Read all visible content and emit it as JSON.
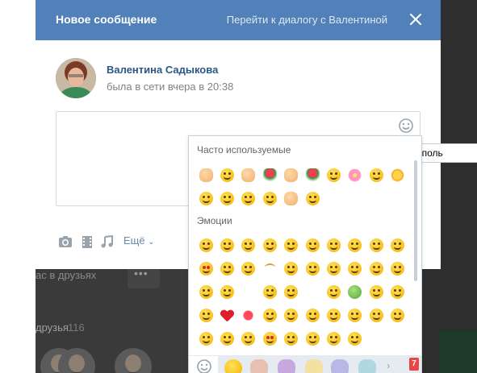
{
  "modal": {
    "title": "Новое сообщение",
    "goto_dialog": "Перейти к диалогу с Валентиной",
    "close_icon": "close-icon"
  },
  "recipient": {
    "name": "Валентина Садыкова",
    "status": "была в сети вчера в 20:38"
  },
  "composer": {
    "message_value": "",
    "smile_icon": "smile-icon"
  },
  "attachments": {
    "photo_icon": "camera-icon",
    "video_icon": "film-icon",
    "audio_icon": "music-note-icon",
    "more_label": "Ещё"
  },
  "tooltip": {
    "text": "Исполь"
  },
  "emoji_panel": {
    "frequent_title": "Часто используемые",
    "emotions_title": "Эмоции",
    "frequent": [
      "point-right",
      "grin",
      "point-up",
      "rose",
      "thumbs-up",
      "tulip",
      "frown",
      "cherry-blossom",
      "neutral",
      "sun",
      "smile",
      "grinning",
      "tired",
      "wink",
      "raised-hand",
      "squint-laugh"
    ],
    "emotions": [
      "grin",
      "grinning",
      "smile",
      "tongue",
      "rofl",
      "smirk",
      "wink",
      "crazy",
      "blush",
      "hugging",
      "heart-eyes",
      "sunglasses",
      "rolling-eyes",
      "eyebrow-raise",
      "hushed",
      "unamused",
      "grimace",
      "sob",
      "weary",
      "scream",
      "neutral",
      "unamused",
      "",
      "rolling-eyes",
      "fearful",
      "",
      "astonished",
      "nauseated",
      "flushed",
      "joy",
      "tears-of-joy",
      "heart",
      "kiss-lips",
      "kissing",
      "relieved",
      "hushed",
      "open-mouth",
      "scared",
      "dizzy",
      "thinking",
      "angry",
      "rage",
      "smirk-face",
      "kiss-heart",
      "sleepy",
      "shush",
      "hugging-face",
      "hmm"
    ],
    "sticker_badge": "7"
  },
  "background": {
    "friends_link": "ас в друзьях",
    "more_dots": "•••",
    "friends_title": "друзья",
    "friends_count": "116"
  },
  "colors": {
    "header": "#5181b8",
    "link": "#2a5885",
    "muted": "#828282"
  }
}
